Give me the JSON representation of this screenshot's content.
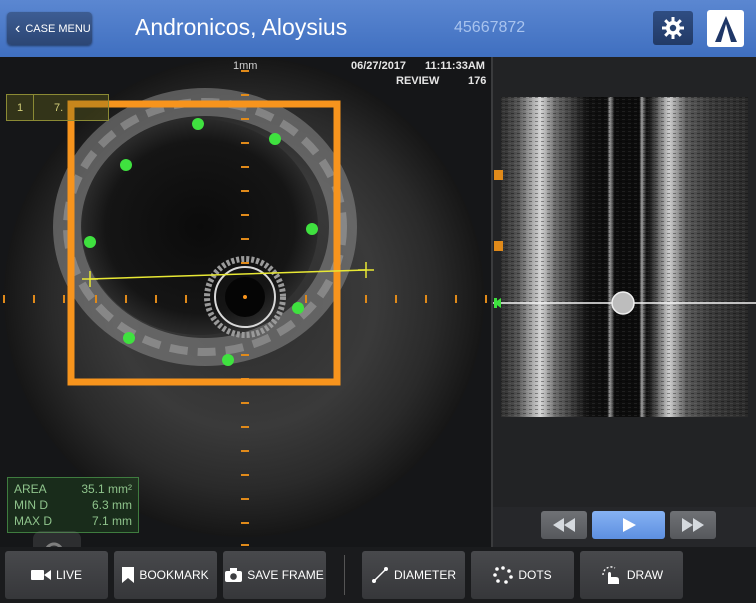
{
  "header": {
    "case_menu_label": "CASE MENU",
    "patient_name": "Andronicos, Aloysius",
    "patient_id": "45667872",
    "settings_icon": "gear-icon",
    "logo_icon": "logo-icon"
  },
  "ivus": {
    "scale_label": "1mm",
    "date": "06/27/2017",
    "time": "11:11:33AM",
    "mode": "REVIEW",
    "frame_count": "176",
    "frame_box": {
      "index": "1",
      "value": "7."
    },
    "measurements": [
      {
        "label": "AREA",
        "value": "35.1 mm²"
      },
      {
        "label": "MIN D",
        "value": "6.3 mm"
      },
      {
        "label": "MAX D",
        "value": "7.1 mm"
      }
    ],
    "zoom_icon": "zoom-icon"
  },
  "longview": {
    "bookmarks": [
      "1",
      "2"
    ]
  },
  "transport": {
    "rewind_icon": "rewind-icon",
    "play_icon": "play-icon",
    "forward_icon": "fast-forward-icon"
  },
  "toolbar": {
    "live_label": "LIVE",
    "bookmark_label": "BOOKMARK",
    "save_frame_label": "SAVE FRAME",
    "diameter_label": "DIAMETER",
    "dots_label": "DOTS",
    "draw_label": "DRAW"
  },
  "colors": {
    "header_blue": "#4a79c8",
    "roi_orange": "#f7941d",
    "dot_green": "#3fe13f",
    "measure_green": "#8fc48c",
    "play_blue": "#78a7ef"
  }
}
